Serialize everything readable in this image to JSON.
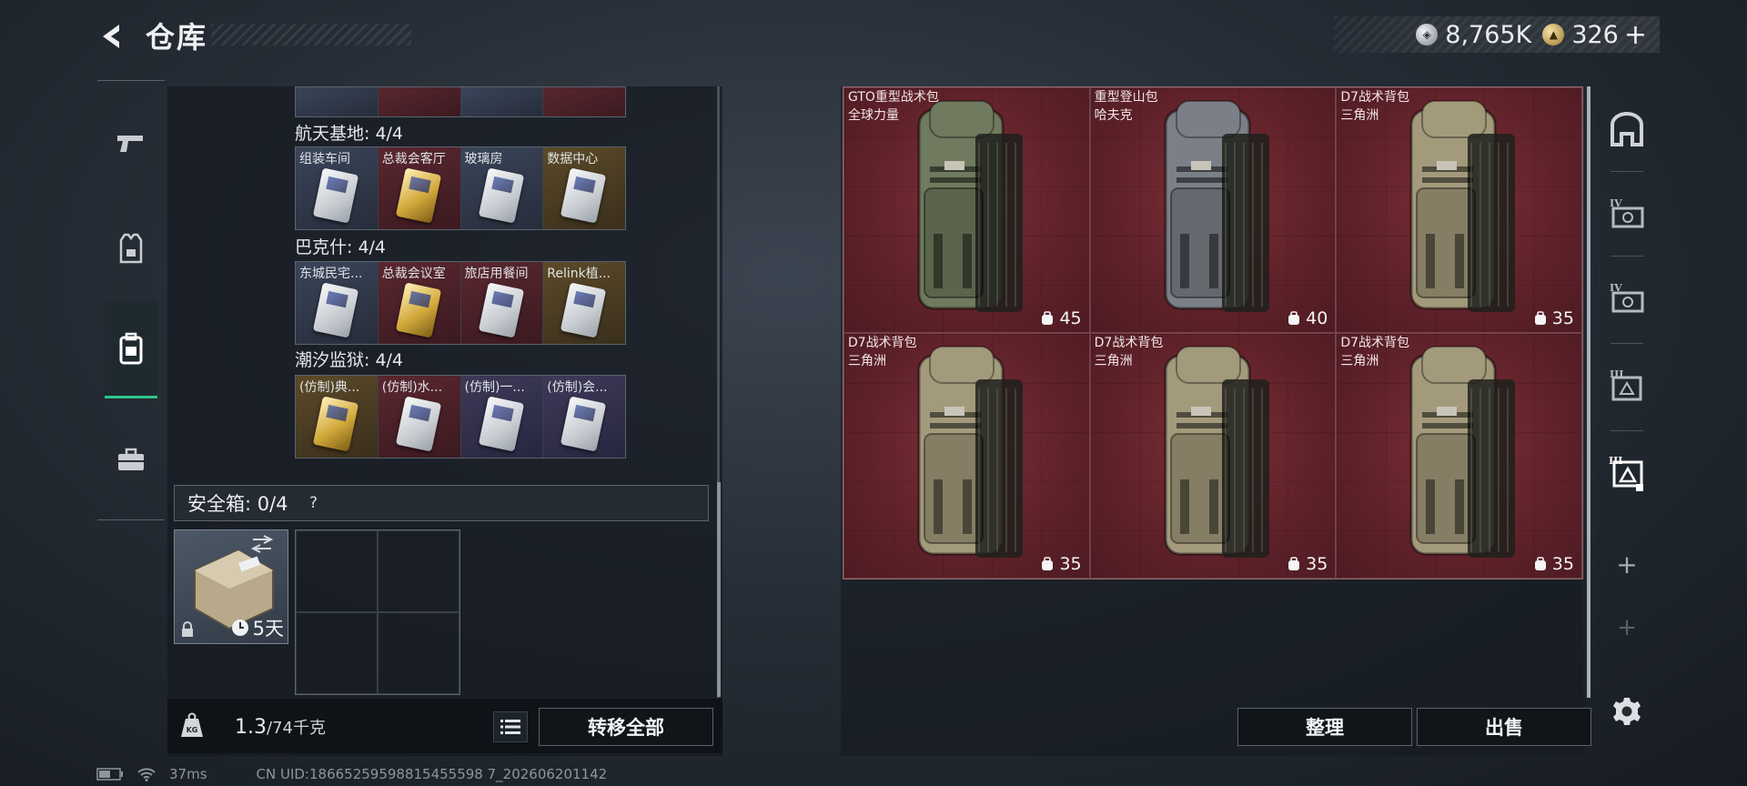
{
  "header": {
    "title": "仓库",
    "silver_amount": "8,765K",
    "gold_amount": "326",
    "plus_label": "+"
  },
  "left_rail": {
    "tabs": [
      {
        "name": "weapons",
        "icon": "pistol-icon"
      },
      {
        "name": "equipment",
        "icon": "vest-icon"
      },
      {
        "name": "backpacks",
        "icon": "backpack-icon",
        "active": true
      },
      {
        "name": "supplies",
        "icon": "toolbox-icon"
      }
    ]
  },
  "key_sections": [
    {
      "label": "航天基地: 4/4",
      "cards": [
        {
          "name": "组装车间",
          "color": "blue",
          "tier": "silver"
        },
        {
          "name": "总裁会客厅",
          "color": "red",
          "tier": "gold"
        },
        {
          "name": "玻璃房",
          "color": "blue",
          "tier": "silver"
        },
        {
          "name": "数据中心",
          "color": "gold",
          "tier": "silver"
        }
      ]
    },
    {
      "label": "巴克什: 4/4",
      "cards": [
        {
          "name": "东城民宅...",
          "color": "blue",
          "tier": "silver"
        },
        {
          "name": "总裁会议室",
          "color": "red",
          "tier": "gold"
        },
        {
          "name": "旅店用餐间",
          "color": "red",
          "tier": "silver"
        },
        {
          "name": "Relink植...",
          "color": "gold",
          "tier": "silver"
        }
      ]
    },
    {
      "label": "潮汐监狱: 4/4",
      "cards": [
        {
          "name": "(仿制)典...",
          "color": "gold",
          "tier": "gold"
        },
        {
          "name": "(仿制)水...",
          "color": "red",
          "tier": "silver"
        },
        {
          "name": "(仿制)一...",
          "color": "purple",
          "tier": "silver"
        },
        {
          "name": "(仿制)会...",
          "color": "purple",
          "tier": "silver"
        }
      ]
    }
  ],
  "safe_box": {
    "label": "安全箱: 0/4",
    "help": "?",
    "item_time": "5天"
  },
  "bottom_bar": {
    "weight_current": "1.3",
    "weight_capacity": "/74千克",
    "transfer_all": "转移全部"
  },
  "backpacks": [
    {
      "name": "GTO重型战术包",
      "maker": "全球力量",
      "capacity": "45",
      "color": "#6f7a5e"
    },
    {
      "name": "重型登山包",
      "maker": "哈夫克",
      "capacity": "40",
      "color": "#7b8088"
    },
    {
      "name": "D7战术背包",
      "maker": "三角洲",
      "capacity": "35",
      "color": "#a39a7c"
    },
    {
      "name": "D7战术背包",
      "maker": "三角洲",
      "capacity": "35",
      "color": "#a39a7c"
    },
    {
      "name": "D7战术背包",
      "maker": "三角洲",
      "capacity": "35",
      "color": "#a39a7c"
    },
    {
      "name": "D7战术背包",
      "maker": "三角洲",
      "capacity": "35",
      "color": "#a39a7c"
    }
  ],
  "actions": {
    "organize": "整理",
    "sell": "出售"
  },
  "status_bar": {
    "ping": "37ms",
    "uid": "CN UID:18665259598815455598 7_202606201142"
  }
}
